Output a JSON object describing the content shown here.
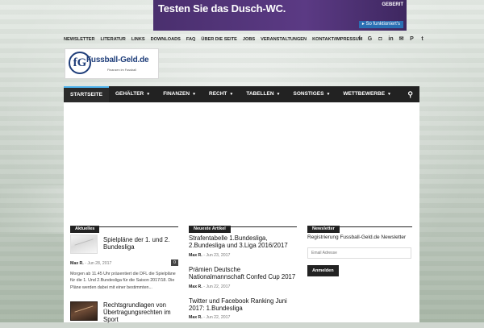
{
  "ad": {
    "headline": "Testen Sie das Dusch-WC.",
    "brand": "GEBERIT",
    "cta": "▸ So funktioniert's"
  },
  "topnav": [
    "NEWSLETTER",
    "LITERATUR",
    "LINKS",
    "DOWNLOADS",
    "FAQ",
    "ÜBER DIE SEITE",
    "JOBS",
    "VERANSTALTUNGEN",
    "KONTAKT/IMPRESSUM"
  ],
  "social_icons": [
    "facebook-icon",
    "google-plus-icon",
    "instagram-icon",
    "linkedin-icon",
    "mail-icon",
    "pinterest-icon",
    "twitter-icon"
  ],
  "logo": {
    "mark": "fG",
    "title": "Fussball-Geld.de",
    "subtitle": "Finanzen im Fussball"
  },
  "mainnav": [
    {
      "label": "STARTSEITE",
      "active": true,
      "caret": false
    },
    {
      "label": "GEHÄLTER",
      "caret": true
    },
    {
      "label": "FINANZEN",
      "caret": true
    },
    {
      "label": "RECHT",
      "caret": true
    },
    {
      "label": "TABELLEN",
      "caret": true
    },
    {
      "label": "SONSTIGES",
      "caret": true
    },
    {
      "label": "WETTBEWERBE",
      "caret": true
    }
  ],
  "col1": {
    "title": "Aktuelles",
    "post1": {
      "title": "Spielpläne der 1. und 2. Bundesliga",
      "author": "Max R.",
      "date": "Jun 28, 2017",
      "comments": "0",
      "excerpt": "Morgen ab 11.45 Uhr präsentiert die DFL die Spielpläne für die 1. Und 2.Bundesliga für die Saison 2017/18. Die Pläne werden dabei mit einer bestimmten..."
    },
    "post2": {
      "title": "Rechtsgrundlagen von Übertragungsrechten im Sport"
    }
  },
  "col2": {
    "title": "Neueste Artikel",
    "posts": [
      {
        "title": "Strafentabelle 1.Bundesliga, 2.Bundesliga und 3.Liga 2016/2017",
        "author": "Max R.",
        "date": "Jun 23, 2017"
      },
      {
        "title": "Prämien Deutsche Nationalmannschaft Confed Cup 2017",
        "author": "Max R.",
        "date": "Jun 22, 2017"
      },
      {
        "title": "Twitter und Facebook Ranking Juni 2017: 1.Bundesliga",
        "author": "Max R.",
        "date": "Jun 22, 2017"
      }
    ]
  },
  "col3": {
    "title": "Newsletter",
    "text": "Registrierung Fussball-Geld.de Newsletter",
    "placeholder": "Email Adresse",
    "button": "Anmelden"
  }
}
